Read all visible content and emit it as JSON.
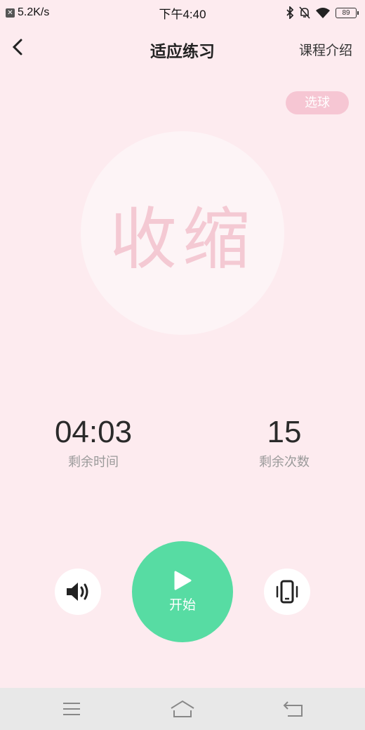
{
  "status_bar": {
    "net_speed": "5.2K/s",
    "time": "下午4:40",
    "battery": "89",
    "notif_icon": "close-x"
  },
  "nav": {
    "title": "适应练习",
    "right_link": "课程介绍"
  },
  "pick_ball_label": "选球",
  "action_text": "收缩",
  "stats": {
    "time_value": "04:03",
    "time_label": "剩余时间",
    "count_value": "15",
    "count_label": "剩余次数"
  },
  "controls": {
    "start_label": "开始"
  },
  "colors": {
    "background": "#fdebef",
    "accent": "#57dca3",
    "pill": "#f6c6d3",
    "action_text": "#f4c9d3"
  }
}
